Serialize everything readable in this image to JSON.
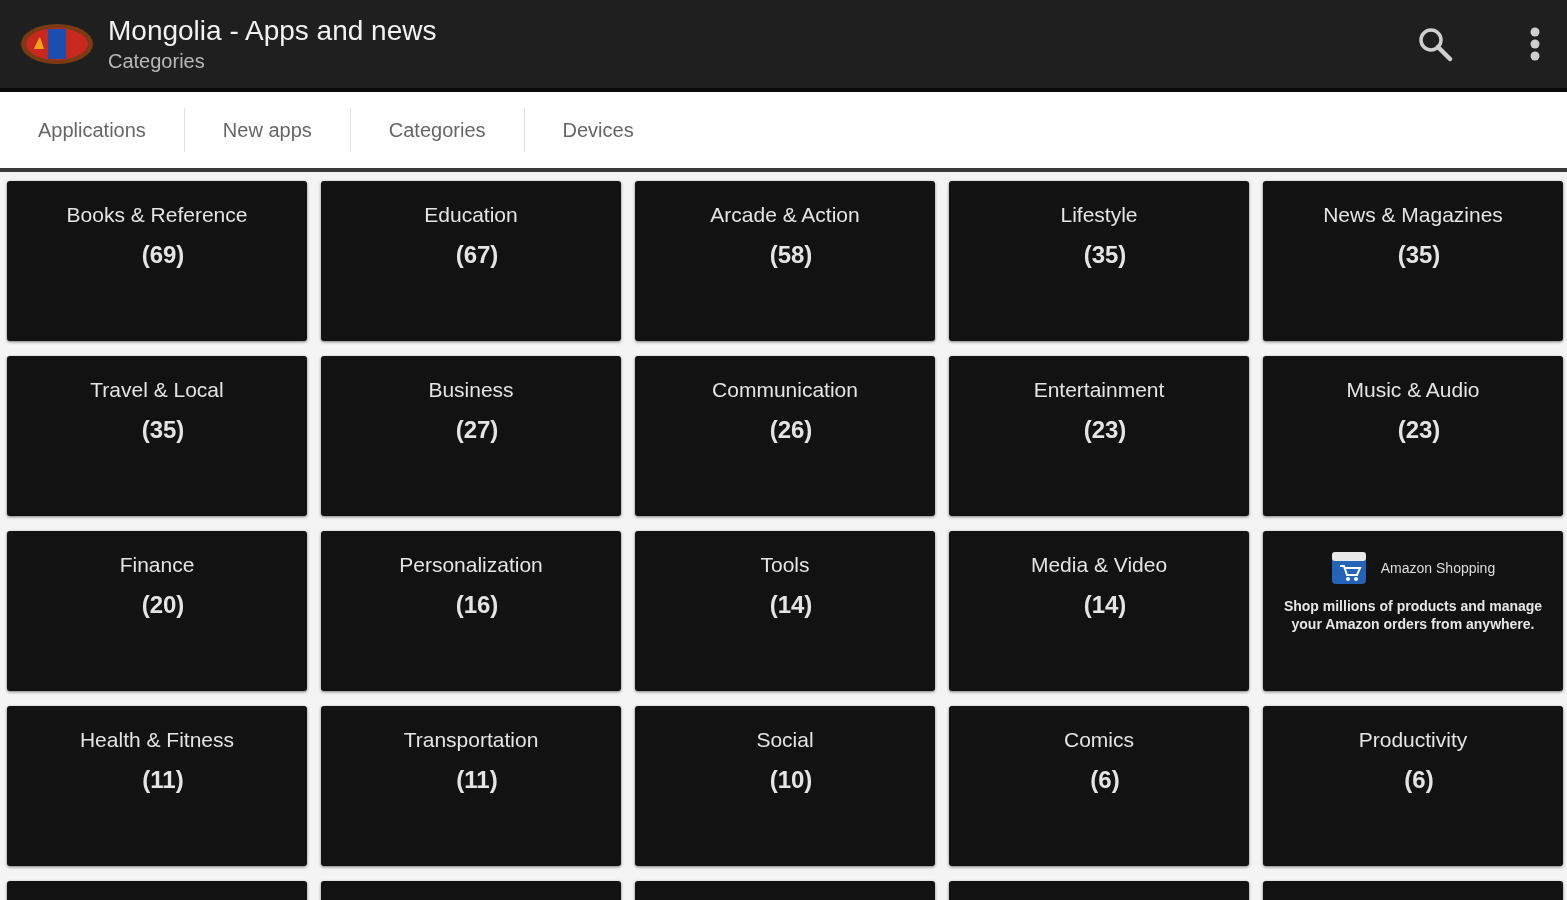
{
  "app_bar": {
    "title": "Mongolia - Apps and news",
    "subtitle": "Categories"
  },
  "tabs": [
    {
      "label": "Applications"
    },
    {
      "label": "New apps"
    },
    {
      "label": "Categories"
    },
    {
      "label": "Devices"
    }
  ],
  "tiles": [
    {
      "kind": "category",
      "name": "Books & Reference",
      "count": "(69)"
    },
    {
      "kind": "category",
      "name": "Education",
      "count": "(67)"
    },
    {
      "kind": "category",
      "name": "Arcade & Action",
      "count": "(58)"
    },
    {
      "kind": "category",
      "name": "Lifestyle",
      "count": "(35)"
    },
    {
      "kind": "category",
      "name": "News & Magazines",
      "count": "(35)"
    },
    {
      "kind": "category",
      "name": "Travel & Local",
      "count": "(35)"
    },
    {
      "kind": "category",
      "name": "Business",
      "count": "(27)"
    },
    {
      "kind": "category",
      "name": "Communication",
      "count": "(26)"
    },
    {
      "kind": "category",
      "name": "Entertainment",
      "count": "(23)"
    },
    {
      "kind": "category",
      "name": "Music & Audio",
      "count": "(23)"
    },
    {
      "kind": "category",
      "name": "Finance",
      "count": "(20)"
    },
    {
      "kind": "category",
      "name": "Personalization",
      "count": "(16)"
    },
    {
      "kind": "category",
      "name": "Tools",
      "count": "(14)"
    },
    {
      "kind": "category",
      "name": "Media & Video",
      "count": "(14)"
    },
    {
      "kind": "ad",
      "name": "Amazon Shopping",
      "text": "Shop millions of products and manage your Amazon orders from anywhere."
    },
    {
      "kind": "category",
      "name": "Health & Fitness",
      "count": "(11)"
    },
    {
      "kind": "category",
      "name": "Transportation",
      "count": "(11)"
    },
    {
      "kind": "category",
      "name": "Social",
      "count": "(10)"
    },
    {
      "kind": "category",
      "name": "Comics",
      "count": "(6)"
    },
    {
      "kind": "category",
      "name": "Productivity",
      "count": "(6)"
    },
    {
      "kind": "blank"
    },
    {
      "kind": "blank"
    },
    {
      "kind": "blank"
    },
    {
      "kind": "blank"
    },
    {
      "kind": "blank"
    }
  ]
}
